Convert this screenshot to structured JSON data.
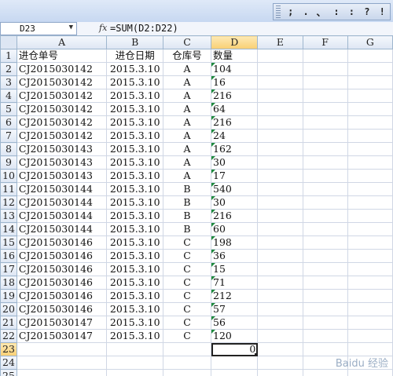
{
  "toolbar": {
    "punct_buttons": [
      ";",
      ".",
      "、",
      ":",
      ":",
      "?",
      "!"
    ]
  },
  "formula_bar": {
    "name_box": "D23",
    "name_arrow": "▼",
    "fx": "fx",
    "formula": "=SUM(D2:D22)"
  },
  "columns": [
    "A",
    "B",
    "C",
    "D",
    "E",
    "F",
    "G"
  ],
  "header_row": {
    "row": "1",
    "a": "进仓单号",
    "b": "进仓日期",
    "c": "仓库号",
    "d": "数量"
  },
  "rows": [
    {
      "row": "2",
      "a": "CJ2015030142",
      "b": "2015.3.10",
      "c": "A",
      "d": "104"
    },
    {
      "row": "3",
      "a": "CJ2015030142",
      "b": "2015.3.10",
      "c": "A",
      "d": "16"
    },
    {
      "row": "4",
      "a": "CJ2015030142",
      "b": "2015.3.10",
      "c": "A",
      "d": "216"
    },
    {
      "row": "5",
      "a": "CJ2015030142",
      "b": "2015.3.10",
      "c": "A",
      "d": "64"
    },
    {
      "row": "6",
      "a": "CJ2015030142",
      "b": "2015.3.10",
      "c": "A",
      "d": "216"
    },
    {
      "row": "7",
      "a": "CJ2015030142",
      "b": "2015.3.10",
      "c": "A",
      "d": "24"
    },
    {
      "row": "8",
      "a": "CJ2015030143",
      "b": "2015.3.10",
      "c": "A",
      "d": "162"
    },
    {
      "row": "9",
      "a": "CJ2015030143",
      "b": "2015.3.10",
      "c": "A",
      "d": "30"
    },
    {
      "row": "10",
      "a": "CJ2015030143",
      "b": "2015.3.10",
      "c": "A",
      "d": "17"
    },
    {
      "row": "11",
      "a": "CJ2015030144",
      "b": "2015.3.10",
      "c": "B",
      "d": "540"
    },
    {
      "row": "12",
      "a": "CJ2015030144",
      "b": "2015.3.10",
      "c": "B",
      "d": "30"
    },
    {
      "row": "13",
      "a": "CJ2015030144",
      "b": "2015.3.10",
      "c": "B",
      "d": "216"
    },
    {
      "row": "14",
      "a": "CJ2015030144",
      "b": "2015.3.10",
      "c": "B",
      "d": "60"
    },
    {
      "row": "15",
      "a": "CJ2015030146",
      "b": "2015.3.10",
      "c": "C",
      "d": "198"
    },
    {
      "row": "16",
      "a": "CJ2015030146",
      "b": "2015.3.10",
      "c": "C",
      "d": "36"
    },
    {
      "row": "17",
      "a": "CJ2015030146",
      "b": "2015.3.10",
      "c": "C",
      "d": "15"
    },
    {
      "row": "18",
      "a": "CJ2015030146",
      "b": "2015.3.10",
      "c": "C",
      "d": "71"
    },
    {
      "row": "19",
      "a": "CJ2015030146",
      "b": "2015.3.10",
      "c": "C",
      "d": "212"
    },
    {
      "row": "20",
      "a": "CJ2015030146",
      "b": "2015.3.10",
      "c": "C",
      "d": "57"
    },
    {
      "row": "21",
      "a": "CJ2015030147",
      "b": "2015.3.10",
      "c": "C",
      "d": "56"
    },
    {
      "row": "22",
      "a": "CJ2015030147",
      "b": "2015.3.10",
      "c": "C",
      "d": "120"
    }
  ],
  "active_row": {
    "row": "23",
    "d": "0"
  },
  "empty_rows": [
    "24",
    "25"
  ],
  "watermark": "Baidu 经验",
  "colors": {
    "header_bg": "#dde6f3",
    "selected_header": "#f9cf73",
    "grid_line": "#d0d7e5",
    "error_marker": "#1e8a3e"
  }
}
